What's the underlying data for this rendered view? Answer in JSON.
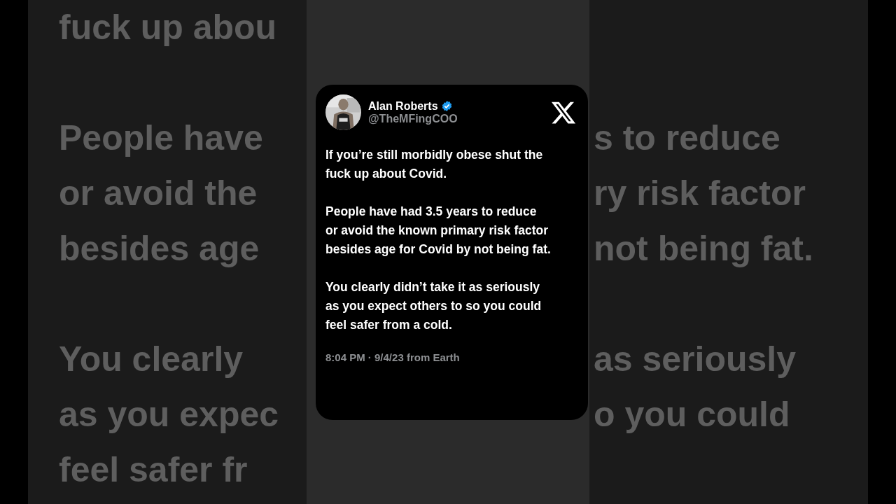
{
  "background_paragraphs": [
    {
      "lines": [
        {
          "left": "fuck up abou"
        }
      ]
    },
    {
      "lines": [
        {
          "left": "People have",
          "right": "s to reduce"
        },
        {
          "left": "or avoid the",
          "right": "ry risk factor"
        },
        {
          "left": "besides age",
          "right": "not being fat."
        }
      ]
    },
    {
      "lines": [
        {
          "left": "You clearly",
          "right": "as seriously"
        },
        {
          "left": "as you expec",
          "right": "o you could"
        },
        {
          "left": "feel safer fr"
        }
      ]
    }
  ],
  "tweet": {
    "name": "Alan Roberts",
    "verified": true,
    "handle": "@TheMFingCOO",
    "paragraphs": [
      "If you’re still morbidly obese shut the\nfuck up about Covid.",
      "People have had 3.5 years to reduce\nor avoid the known primary risk factor\nbesides age for Covid by not being fat.",
      "You clearly didn’t take it as seriously\nas you expect others to so you could\nfeel safer from a cold."
    ],
    "timestamp": "8:04 PM · 9/4/23 from Earth"
  }
}
